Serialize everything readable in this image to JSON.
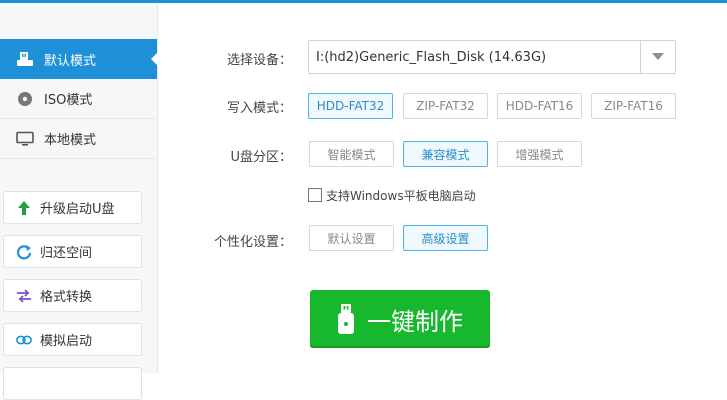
{
  "sidebar": {
    "modes": [
      {
        "label": "默认模式",
        "icon": "usb-drive-icon",
        "active": true
      },
      {
        "label": "ISO模式",
        "icon": "disc-icon",
        "active": false
      },
      {
        "label": "本地模式",
        "icon": "monitor-icon",
        "active": false
      }
    ],
    "tools": [
      {
        "label": "升级启动U盘",
        "icon": "upgrade-arrow-icon"
      },
      {
        "label": "归还空间",
        "icon": "refresh-icon"
      },
      {
        "label": "格式转换",
        "icon": "convert-arrows-icon"
      },
      {
        "label": "模拟启动",
        "icon": "link-icon"
      }
    ]
  },
  "form": {
    "device": {
      "label": "选择设备：",
      "value": "I:(hd2)Generic_Flash_Disk (14.63G)"
    },
    "write_mode": {
      "label": "写入模式：",
      "options": [
        "HDD-FAT32",
        "ZIP-FAT32",
        "HDD-FAT16",
        "ZIP-FAT16"
      ],
      "selected": "HDD-FAT32"
    },
    "partition": {
      "label": "U盘分区：",
      "options": [
        "智能模式",
        "兼容模式",
        "增强模式"
      ],
      "selected": "兼容模式"
    },
    "tablet_checkbox": {
      "label": "支持Windows平板电脑启动",
      "checked": false
    },
    "personalize": {
      "label": "个性化设置：",
      "options": [
        "默认设置",
        "高级设置"
      ],
      "selected": "高级设置"
    },
    "make_button": {
      "label": "一键制作",
      "icon": "usb-stick-icon"
    }
  },
  "colors": {
    "accent": "#1e90d8",
    "make_button": "#17b82d",
    "selected_border": "#4fb4e6"
  }
}
